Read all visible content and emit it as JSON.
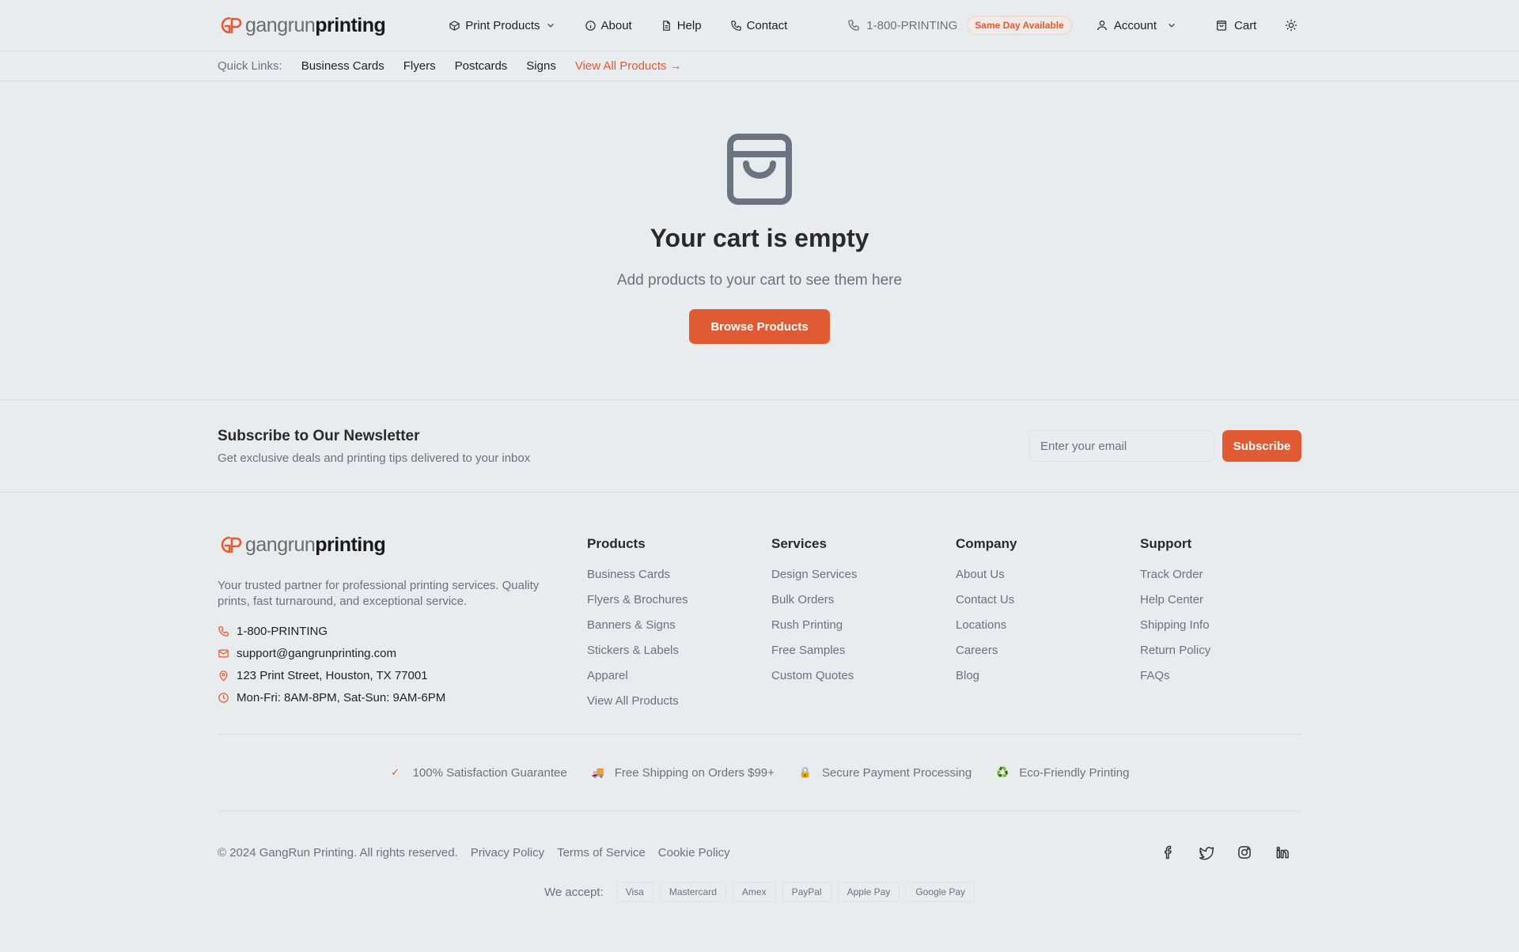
{
  "header": {
    "logo": {
      "part1": "gangrun",
      "part2": "printing"
    },
    "nav": [
      {
        "label": "Print Products",
        "icon": "box-icon",
        "has_dropdown": true
      },
      {
        "label": "About",
        "icon": "info-icon"
      },
      {
        "label": "Help",
        "icon": "document-icon"
      },
      {
        "label": "Contact",
        "icon": "phone-icon"
      }
    ],
    "phone": "1-800-PRINTING",
    "badge": "Same Day Available",
    "account_label": "Account",
    "cart_label": "Cart"
  },
  "quick_links": {
    "label": "Quick Links:",
    "items": [
      "Business Cards",
      "Flyers",
      "Postcards",
      "Signs"
    ],
    "view_all": "View All Products →"
  },
  "empty_cart": {
    "title": "Your cart is empty",
    "subtitle": "Add products to your cart to see them here",
    "button": "Browse Products"
  },
  "newsletter": {
    "title": "Subscribe to Our Newsletter",
    "subtitle": "Get exclusive deals and printing tips delivered to your inbox",
    "placeholder": "Enter your email",
    "button": "Subscribe"
  },
  "footer": {
    "description": "Your trusted partner for professional printing services. Quality prints, fast turnaround, and exceptional service.",
    "contact": {
      "phone": "1-800-PRINTING",
      "email": "support@gangrunprinting.com",
      "address": "123 Print Street, Houston, TX 77001",
      "hours": "Mon-Fri: 8AM-8PM, Sat-Sun: 9AM-6PM"
    },
    "columns": [
      {
        "title": "Products",
        "links": [
          "Business Cards",
          "Flyers & Brochures",
          "Banners & Signs",
          "Stickers & Labels",
          "Apparel",
          "View All Products"
        ]
      },
      {
        "title": "Services",
        "links": [
          "Design Services",
          "Bulk Orders",
          "Rush Printing",
          "Free Samples",
          "Custom Quotes"
        ]
      },
      {
        "title": "Company",
        "links": [
          "About Us",
          "Contact Us",
          "Locations",
          "Careers",
          "Blog"
        ]
      },
      {
        "title": "Support",
        "links": [
          "Track Order",
          "Help Center",
          "Shipping Info",
          "Return Policy",
          "FAQs"
        ]
      }
    ],
    "trust": [
      {
        "icon": "✓",
        "label": "100% Satisfaction Guarantee"
      },
      {
        "icon": "🚚",
        "label": "Free Shipping on Orders $99+"
      },
      {
        "icon": "🔒",
        "label": "Secure Payment Processing"
      },
      {
        "icon": "♻️",
        "label": "Eco-Friendly Printing"
      }
    ],
    "copyright": "© 2024 GangRun Printing. All rights reserved.",
    "legal_links": [
      "Privacy Policy",
      "Terms of Service",
      "Cookie Policy"
    ],
    "socials": [
      "facebook-icon",
      "twitter-icon",
      "instagram-icon",
      "linkedin-icon"
    ],
    "we_accept": "We accept:",
    "payments": [
      "Visa",
      "Mastercard",
      "Amex",
      "PayPal",
      "Apple Pay",
      "Google Pay"
    ]
  },
  "colors": {
    "accent": "#e05a33",
    "background": "#e8ecef",
    "muted": "#6a7280"
  }
}
